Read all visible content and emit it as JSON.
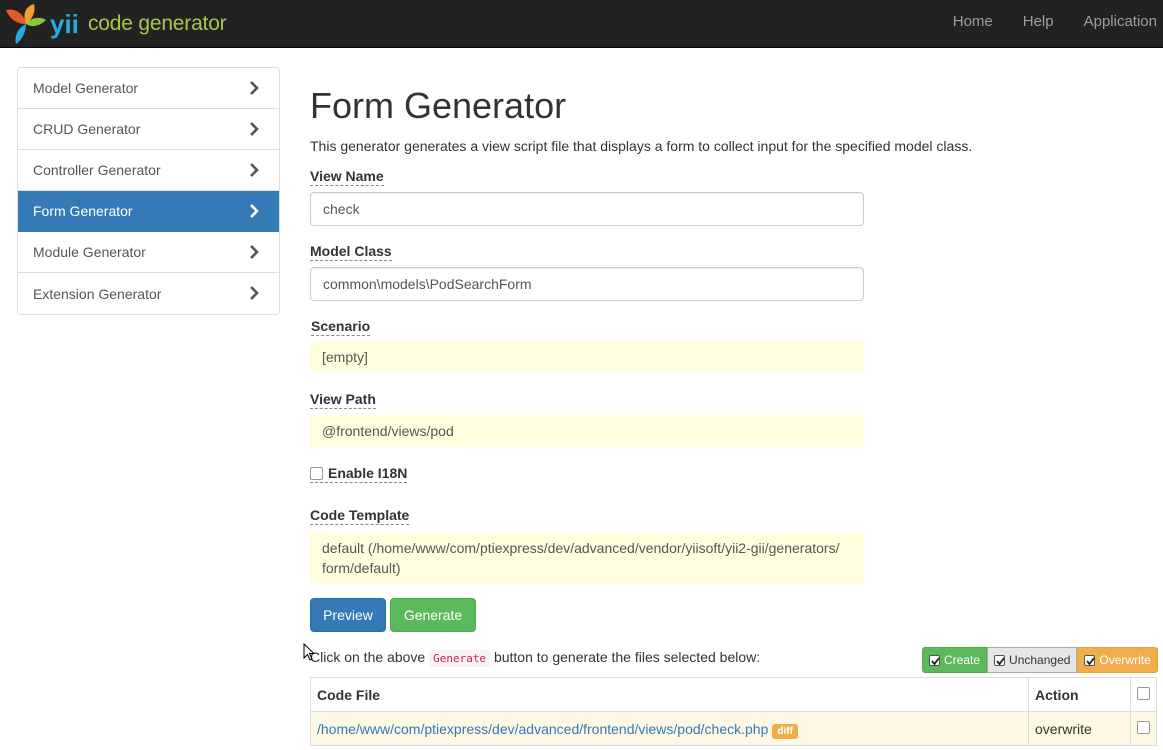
{
  "navbar": {
    "brand_logo": "yii",
    "brand_text": "code generator",
    "links": [
      "Home",
      "Help",
      "Application"
    ]
  },
  "sidebar": {
    "items": [
      {
        "label": "Model Generator",
        "active": false
      },
      {
        "label": "CRUD Generator",
        "active": false
      },
      {
        "label": "Controller Generator",
        "active": false
      },
      {
        "label": "Form Generator",
        "active": true
      },
      {
        "label": "Module Generator",
        "active": false
      },
      {
        "label": "Extension Generator",
        "active": false
      }
    ]
  },
  "main": {
    "title": "Form Generator",
    "description": "This generator generates a view script file that displays a form to collect input for the specified model class.",
    "fields": {
      "view_name": {
        "label": "View Name",
        "value": "check"
      },
      "model_class": {
        "label": "Model Class",
        "value": "common\\models\\PodSearchForm"
      },
      "scenario": {
        "label": "Scenario",
        "value": "[empty]"
      },
      "view_path": {
        "label": "View Path",
        "value": "@frontend/views/pod"
      },
      "enable_i18n": {
        "label": "Enable I18N",
        "checked": false
      },
      "code_template": {
        "label": "Code Template",
        "value_line1": "default (/home/www/com/ptiexpress/dev/advanced/vendor/yiisoft/yii2-gii/generators/",
        "value_line2": "form/default)"
      }
    },
    "buttons": {
      "preview": "Preview",
      "generate": "Generate"
    },
    "info": {
      "before": "Click on the above",
      "code": "Generate",
      "after": "button to generate the files selected below:"
    },
    "legend": {
      "create": "Create",
      "unchanged": "Unchanged",
      "overwrite": "Overwrite"
    },
    "table": {
      "headers": {
        "file": "Code File",
        "action": "Action"
      },
      "rows": [
        {
          "file": "/home/www/com/ptiexpress/dev/advanced/frontend/views/pod/check.php",
          "badge": "diff",
          "action": "overwrite"
        }
      ]
    }
  },
  "colors": {
    "navbar_bg": "#222222",
    "brand_green": "#a8c44a",
    "primary": "#337ab7",
    "success": "#5cb85c",
    "warning": "#f0ad4e",
    "sticky_bg": "#ffffe0"
  }
}
